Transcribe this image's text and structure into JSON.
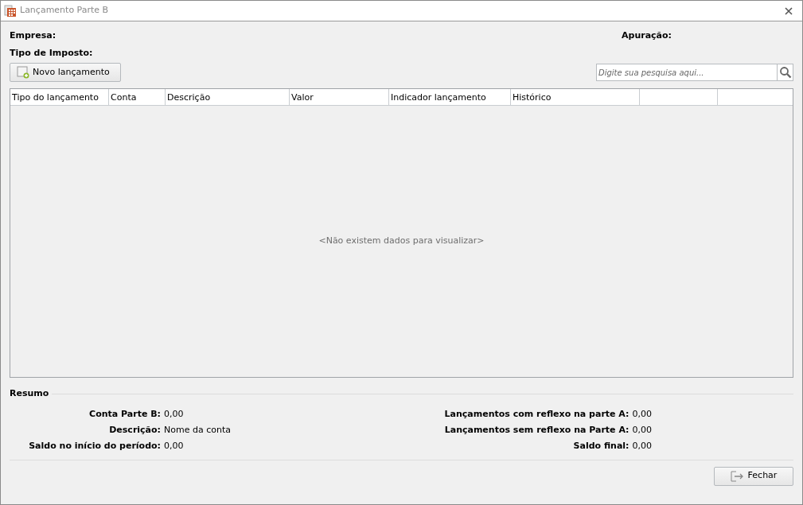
{
  "window": {
    "title": "Lançamento Parte B"
  },
  "header": {
    "company_label": "Empresa:",
    "period_label": "Apuração:",
    "tax_type_label": "Tipo de Imposto:"
  },
  "new_button": {
    "label": "Novo lançamento"
  },
  "search": {
    "placeholder": "Digite sua pesquisa aqui..."
  },
  "table": {
    "columns": [
      "Tipo do lançamento",
      "Conta",
      "Descrição",
      "Valor",
      "Indicador lançamento",
      "Histórico"
    ],
    "empty_message": "<Não existem dados para visualizar>"
  },
  "summary": {
    "title": "Resumo",
    "left": [
      {
        "label": "Conta Parte B:",
        "value": "0,00"
      },
      {
        "label": "Descrição:",
        "value": "Nome da conta"
      },
      {
        "label": "Saldo no início do período:",
        "value": "0,00"
      }
    ],
    "right": [
      {
        "label": "Lançamentos com reflexo na parte A:",
        "value": "0,00"
      },
      {
        "label": "Lançamentos sem reflexo na Parte A:",
        "value": "0,00"
      },
      {
        "label": "Saldo final:",
        "value": "0,00"
      }
    ]
  },
  "close_button": {
    "label": "Fechar"
  }
}
